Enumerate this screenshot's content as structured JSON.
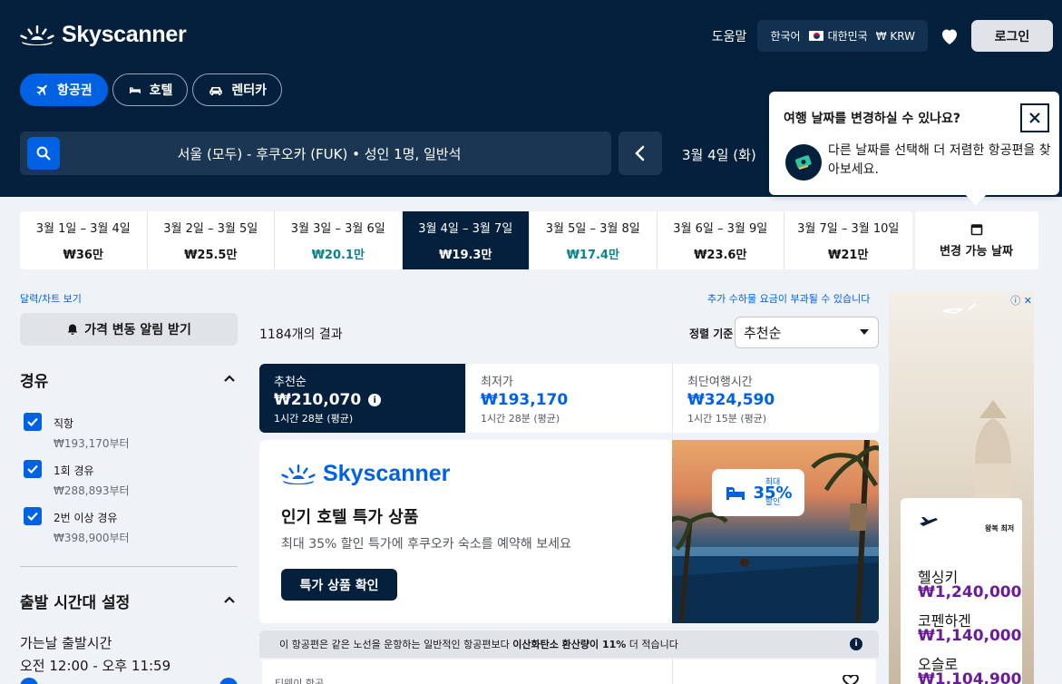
{
  "brand": {
    "name": "Skyscanner"
  },
  "header": {
    "help": "도움말",
    "locale": {
      "language": "한국어",
      "country": "대한민국",
      "currency": "₩ KRW"
    },
    "login": "로그인",
    "tabs": [
      {
        "label": "항공권",
        "icon": "plane-icon",
        "active": true
      },
      {
        "label": "호텔",
        "icon": "bed-icon",
        "active": false
      },
      {
        "label": "렌터카",
        "icon": "car-icon",
        "active": false
      }
    ],
    "search_summary": "서울 (모두) - 후쿠오카 (FUK)  •  성인 1명, 일반석",
    "date": "3월 4일 (화)"
  },
  "popup": {
    "title": "여행 날짜를 변경하실 수 있나요?",
    "body": "다른 날짜를 선택해 더 저렴한 항공편을 찾아보세요."
  },
  "date_strip": [
    {
      "label": "3월 1일 – 3월 4일",
      "price": "₩36만",
      "cheap": false,
      "selected": false
    },
    {
      "label": "3월 2일 – 3월 5일",
      "price": "₩25.5만",
      "cheap": false,
      "selected": false
    },
    {
      "label": "3월 3일 – 3월 6일",
      "price": "₩20.1만",
      "cheap": true,
      "selected": false
    },
    {
      "label": "3월 4일 – 3월 7일",
      "price": "₩19.3만",
      "cheap": false,
      "selected": true
    },
    {
      "label": "3월 5일 – 3월 8일",
      "price": "₩17.4만",
      "cheap": true,
      "selected": false
    },
    {
      "label": "3월 6일 – 3월 9일",
      "price": "₩23.6만",
      "cheap": false,
      "selected": false
    },
    {
      "label": "3월 7일 – 3월 10일",
      "price": "₩21만",
      "cheap": false,
      "selected": false
    }
  ],
  "flexible_dates": "변경 가능 날짜",
  "sidebar": {
    "calendar_link": "달력/차트 보기",
    "alert_button": "가격 변동 알림 받기",
    "stops_title": "경유",
    "stops": [
      {
        "label": "직항",
        "price": "₩193,170부터",
        "checked": true
      },
      {
        "label": "1회 경유",
        "price": "₩288,893부터",
        "checked": true
      },
      {
        "label": "2번 이상 경유",
        "price": "₩398,900부터",
        "checked": true
      }
    ],
    "departure_title": "출발 시간대 설정",
    "outbound_label": "가는날 출발시간",
    "outbound_range": "오전 12:00 - 오후 11:59"
  },
  "results": {
    "fees_note": "추가 수하물 요금이 부과될 수 있습니다",
    "count": "1184개의 결과",
    "sort_label": "정렬 기준",
    "sort_value": "추천순",
    "sort_tabs": [
      {
        "title": "추천순",
        "price": "₩210,070",
        "duration": "1시간 28분 (평균)",
        "active": true
      },
      {
        "title": "최저가",
        "price": "₩193,170",
        "duration": "1시간 28분 (평균)",
        "active": false
      },
      {
        "title": "최단여행시간",
        "price": "₩324,590",
        "duration": "1시간 15분 (평균)",
        "active": false
      }
    ]
  },
  "promo": {
    "title": "인기 호텔 특가 상품",
    "subtitle": "최대 35% 할인 특가에 후쿠오카 숙소를 예약해 보세요",
    "button": "특가 상품 확인",
    "badge_top": "최대",
    "badge_value": "35%",
    "badge_bottom": "할인"
  },
  "eco_note": {
    "prefix": "이 항공편은 같은 노선을 운항하는 일반적인 항공편보다 ",
    "bold": "이산화탄소 환산량이 11%",
    "suffix": " 더 적습니다"
  },
  "flight_card": {
    "airline": "티웨이 항공"
  },
  "side_ad": {
    "header": "왕복 최저",
    "cities": [
      {
        "name": "헬싱키",
        "price": "₩1,240,000"
      },
      {
        "name": "코펜하겐",
        "price": "₩1,140,000"
      },
      {
        "name": "오슬로",
        "price": "₩1,104,900"
      }
    ]
  },
  "colors": {
    "navy": "#05203c",
    "blue": "#0062e3",
    "teal": "#0c838a",
    "ad_purple": "#6a1b9a"
  }
}
